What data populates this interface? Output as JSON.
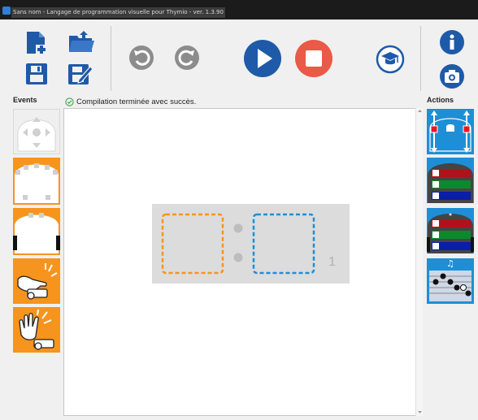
{
  "window": {
    "title": "Sans nom - Langage de programmation visuelle pour Thymio - ver. 1.3.90"
  },
  "toolbar": {
    "new": {
      "icon": "new-file-icon"
    },
    "open": {
      "icon": "open-folder-icon"
    },
    "save": {
      "icon": "save-icon"
    },
    "save_as": {
      "icon": "save-as-icon"
    },
    "undo": {
      "icon": "undo-icon"
    },
    "redo": {
      "icon": "redo-icon"
    },
    "run": {
      "icon": "play-icon",
      "color": "#1e5aa8"
    },
    "stop": {
      "icon": "stop-icon",
      "color": "#e95a47"
    },
    "advanced": {
      "icon": "graduation-cap-icon"
    },
    "info": {
      "icon": "info-icon"
    },
    "screenshot": {
      "icon": "camera-icon"
    }
  },
  "status": {
    "text": "Compilation terminée avec succès."
  },
  "panels": {
    "events_label": "Events",
    "actions_label": "Actions"
  },
  "events": [
    {
      "name": "buttons-event",
      "icon": "arrow-buttons-icon"
    },
    {
      "name": "front-proximity-event",
      "icon": "front-sensors-icon"
    },
    {
      "name": "ground-proximity-event",
      "icon": "ground-sensors-icon"
    },
    {
      "name": "tap-event",
      "icon": "tap-icon"
    },
    {
      "name": "clap-event",
      "icon": "clap-icon"
    }
  ],
  "actions": [
    {
      "name": "motors-action",
      "icon": "motors-icon"
    },
    {
      "name": "top-color-action",
      "icon": "top-color-icon"
    },
    {
      "name": "bottom-color-action",
      "icon": "bottom-color-icon"
    },
    {
      "name": "music-action",
      "icon": "music-note-icon",
      "glyph": "♫"
    }
  ],
  "program": {
    "row_number": "1"
  },
  "colors": {
    "event_orange": "#f7941d",
    "action_blue": "#1e8fd6",
    "accent_blue": "#1e5aa8"
  }
}
